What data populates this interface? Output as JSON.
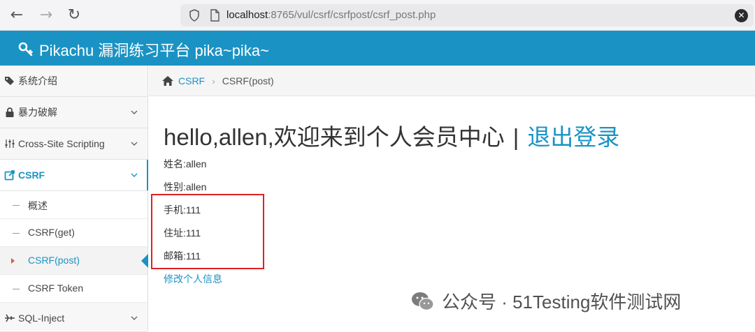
{
  "browser": {
    "url_host": "localhost",
    "url_rest": ":8765/vul/csrf/csrfpost/csrf_post.php",
    "back_glyph": "←",
    "forward_glyph": "→",
    "reload_glyph": "↻",
    "clear_glyph": "✕"
  },
  "header": {
    "title": "Pikachu 漏洞练习平台 pika~pika~"
  },
  "sidebar": {
    "items": [
      {
        "label": "系统介绍"
      },
      {
        "label": "暴力破解"
      },
      {
        "label": "Cross-Site Scripting"
      },
      {
        "label": "CSRF"
      },
      {
        "label": "SQL-Inject"
      }
    ],
    "csrf_sub": [
      {
        "label": "概述"
      },
      {
        "label": "CSRF(get)"
      },
      {
        "label": "CSRF(post)"
      },
      {
        "label": "CSRF Token"
      }
    ]
  },
  "breadcrumb": {
    "section": "CSRF",
    "current": "CSRF(post)",
    "separator": "›"
  },
  "main": {
    "greeting": "hello,allen,欢迎来到个人会员中心",
    "divider": "|",
    "logout": "退出登录",
    "name": "姓名:allen",
    "gender": "性别:allen",
    "phone": "手机:111",
    "address": "住址:111",
    "email": "邮箱:111",
    "edit_link": "修改个人信息"
  },
  "watermark": {
    "text": "公众号 · 51Testing软件测试网"
  },
  "colors": {
    "accent": "#1a93c4",
    "highlight": "#e02020"
  }
}
